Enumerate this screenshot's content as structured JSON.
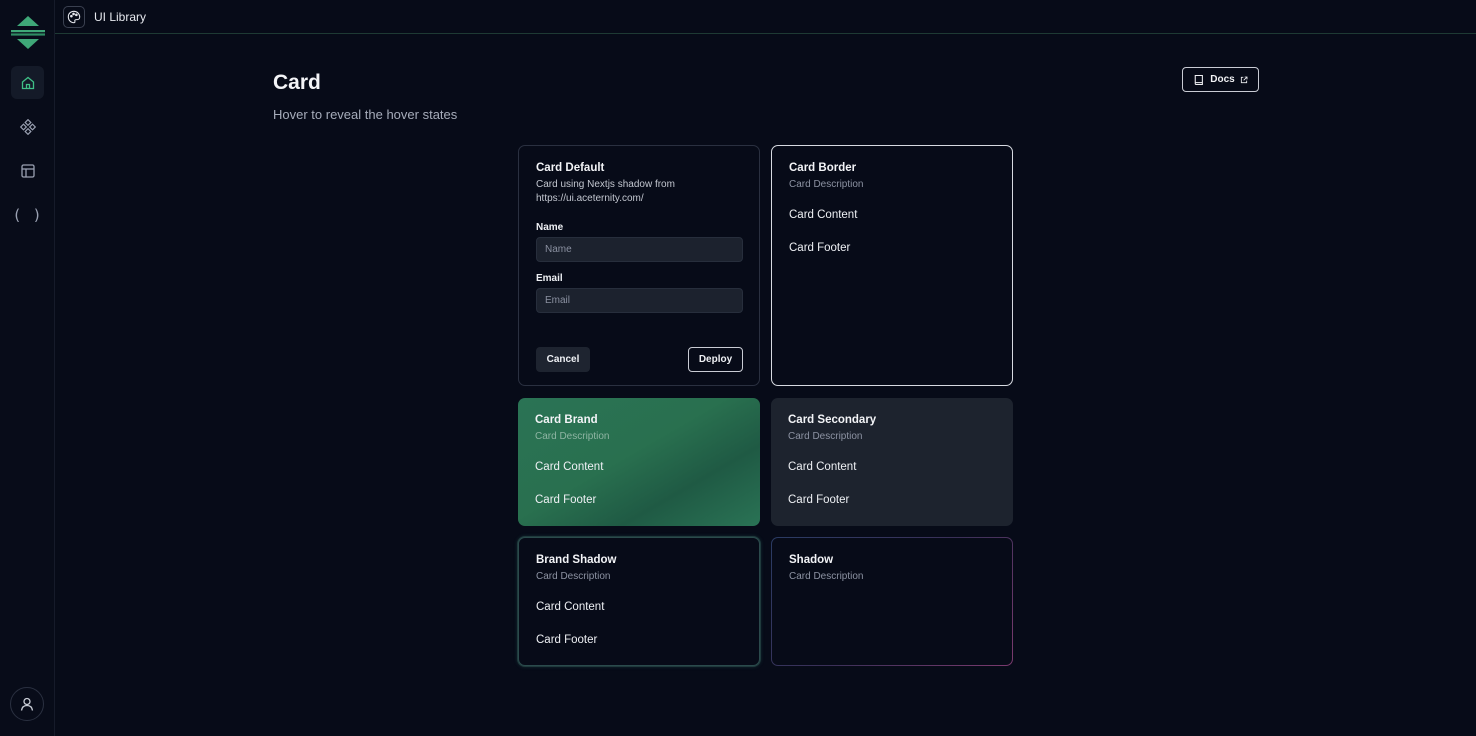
{
  "app": {
    "title": "UI Library"
  },
  "sidebar": {
    "items": [
      {
        "name": "home",
        "icon": "home-icon",
        "active": true
      },
      {
        "name": "components",
        "icon": "components-icon",
        "active": false
      },
      {
        "name": "layout",
        "icon": "layout-icon",
        "active": false
      },
      {
        "name": "code",
        "icon": "parentheses-icon",
        "label": "( )",
        "active": false
      }
    ],
    "user_icon": "user-icon"
  },
  "header": {
    "title": "Card",
    "subtitle": "Hover to reveal the hover states",
    "docs_label": "Docs"
  },
  "cards": {
    "default": {
      "title": "Card Default",
      "description": "Card using Nextjs shadow from https://ui.aceternity.com/",
      "name_label": "Name",
      "name_placeholder": "Name",
      "email_label": "Email",
      "email_placeholder": "Email",
      "cancel_label": "Cancel",
      "deploy_label": "Deploy"
    },
    "border": {
      "title": "Card Border",
      "description": "Card Description",
      "content": "Card Content",
      "footer": "Card Footer"
    },
    "brand": {
      "title": "Card Brand",
      "description": "Card Description",
      "content": "Card Content",
      "footer": "Card Footer"
    },
    "secondary": {
      "title": "Card Secondary",
      "description": "Card Description",
      "content": "Card Content",
      "footer": "Card Footer"
    },
    "brand_shadow": {
      "title": "Brand Shadow",
      "description": "Card Description",
      "content": "Card Content",
      "footer": "Card Footer"
    },
    "shadow": {
      "title": "Shadow",
      "description": "Card Description"
    }
  },
  "colors": {
    "background": "#070b18",
    "brand": "#2a7355",
    "accent": "#3fbf86"
  }
}
